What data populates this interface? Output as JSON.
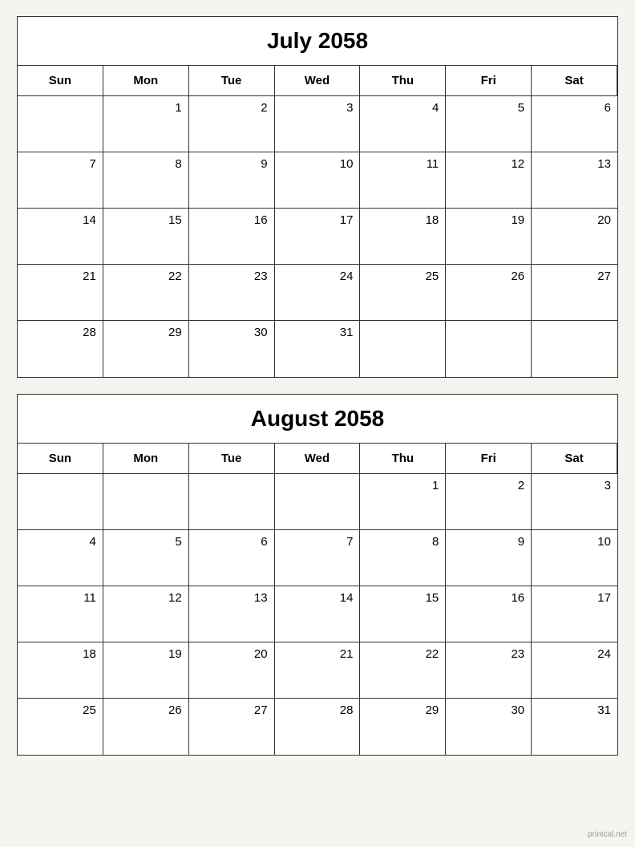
{
  "july": {
    "title": "July 2058",
    "headers": [
      "Sun",
      "Mon",
      "Tue",
      "Wed",
      "Thu",
      "Fri",
      "Sat"
    ],
    "weeks": [
      [
        {
          "day": "",
          "empty": true
        },
        {
          "day": "1"
        },
        {
          "day": "2"
        },
        {
          "day": "3"
        },
        {
          "day": "4"
        },
        {
          "day": "5"
        },
        {
          "day": "6"
        }
      ],
      [
        {
          "day": "7"
        },
        {
          "day": "8"
        },
        {
          "day": "9"
        },
        {
          "day": "10"
        },
        {
          "day": "11"
        },
        {
          "day": "12"
        },
        {
          "day": "13"
        }
      ],
      [
        {
          "day": "14"
        },
        {
          "day": "15"
        },
        {
          "day": "16"
        },
        {
          "day": "17"
        },
        {
          "day": "18"
        },
        {
          "day": "19"
        },
        {
          "day": "20"
        }
      ],
      [
        {
          "day": "21"
        },
        {
          "day": "22"
        },
        {
          "day": "23"
        },
        {
          "day": "24"
        },
        {
          "day": "25"
        },
        {
          "day": "26"
        },
        {
          "day": "27"
        }
      ],
      [
        {
          "day": "28"
        },
        {
          "day": "29"
        },
        {
          "day": "30"
        },
        {
          "day": "31"
        },
        {
          "day": "",
          "empty": true
        },
        {
          "day": "",
          "empty": true
        },
        {
          "day": "",
          "empty": true
        }
      ]
    ]
  },
  "august": {
    "title": "August 2058",
    "headers": [
      "Sun",
      "Mon",
      "Tue",
      "Wed",
      "Thu",
      "Fri",
      "Sat"
    ],
    "weeks": [
      [
        {
          "day": "",
          "empty": true
        },
        {
          "day": "",
          "empty": true
        },
        {
          "day": "",
          "empty": true
        },
        {
          "day": "",
          "empty": true
        },
        {
          "day": "1"
        },
        {
          "day": "2"
        },
        {
          "day": "3"
        }
      ],
      [
        {
          "day": "4"
        },
        {
          "day": "5"
        },
        {
          "day": "6"
        },
        {
          "day": "7"
        },
        {
          "day": "8"
        },
        {
          "day": "9"
        },
        {
          "day": "10"
        }
      ],
      [
        {
          "day": "11"
        },
        {
          "day": "12"
        },
        {
          "day": "13"
        },
        {
          "day": "14"
        },
        {
          "day": "15"
        },
        {
          "day": "16"
        },
        {
          "day": "17"
        }
      ],
      [
        {
          "day": "18"
        },
        {
          "day": "19"
        },
        {
          "day": "20"
        },
        {
          "day": "21"
        },
        {
          "day": "22"
        },
        {
          "day": "23"
        },
        {
          "day": "24"
        }
      ],
      [
        {
          "day": "25"
        },
        {
          "day": "26"
        },
        {
          "day": "27"
        },
        {
          "day": "28"
        },
        {
          "day": "29"
        },
        {
          "day": "30"
        },
        {
          "day": "31"
        }
      ]
    ]
  },
  "watermark": "printcal.net"
}
